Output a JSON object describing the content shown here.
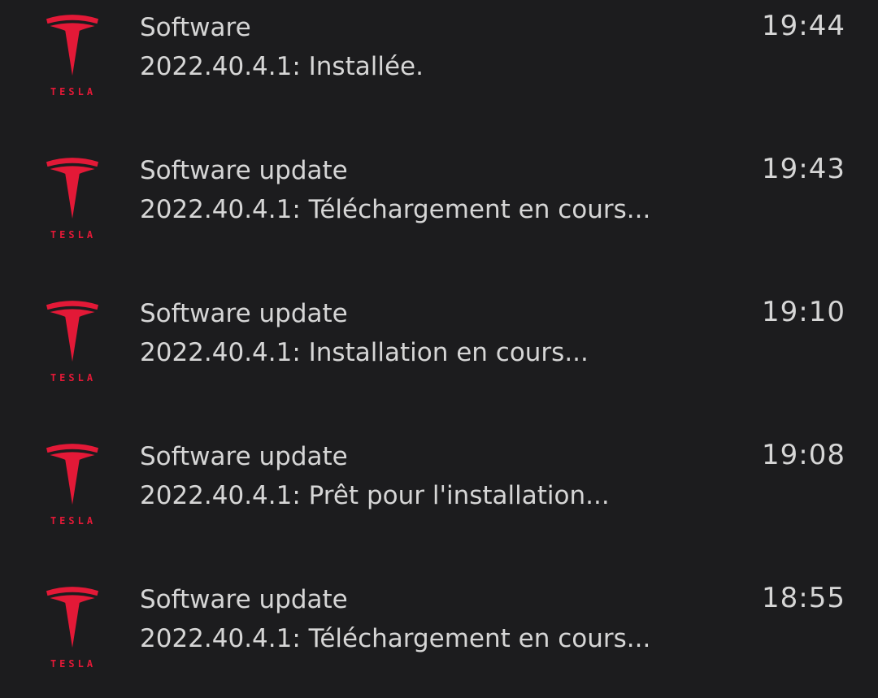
{
  "brand": {
    "wordmark": "TESLA",
    "color": "#e31937"
  },
  "notifications": [
    {
      "title": "Software",
      "message": "2022.40.4.1: Installée.",
      "time": "19:44"
    },
    {
      "title": "Software update",
      "message": "2022.40.4.1: Téléchargement en cours...",
      "time": "19:43"
    },
    {
      "title": "Software update",
      "message": "2022.40.4.1: Installation en cours...",
      "time": "19:10"
    },
    {
      "title": "Software update",
      "message": "2022.40.4.1: Prêt pour l'installation...",
      "time": "19:08"
    },
    {
      "title": "Software update",
      "message": "2022.40.4.1: Téléchargement en cours...",
      "time": "18:55"
    }
  ]
}
